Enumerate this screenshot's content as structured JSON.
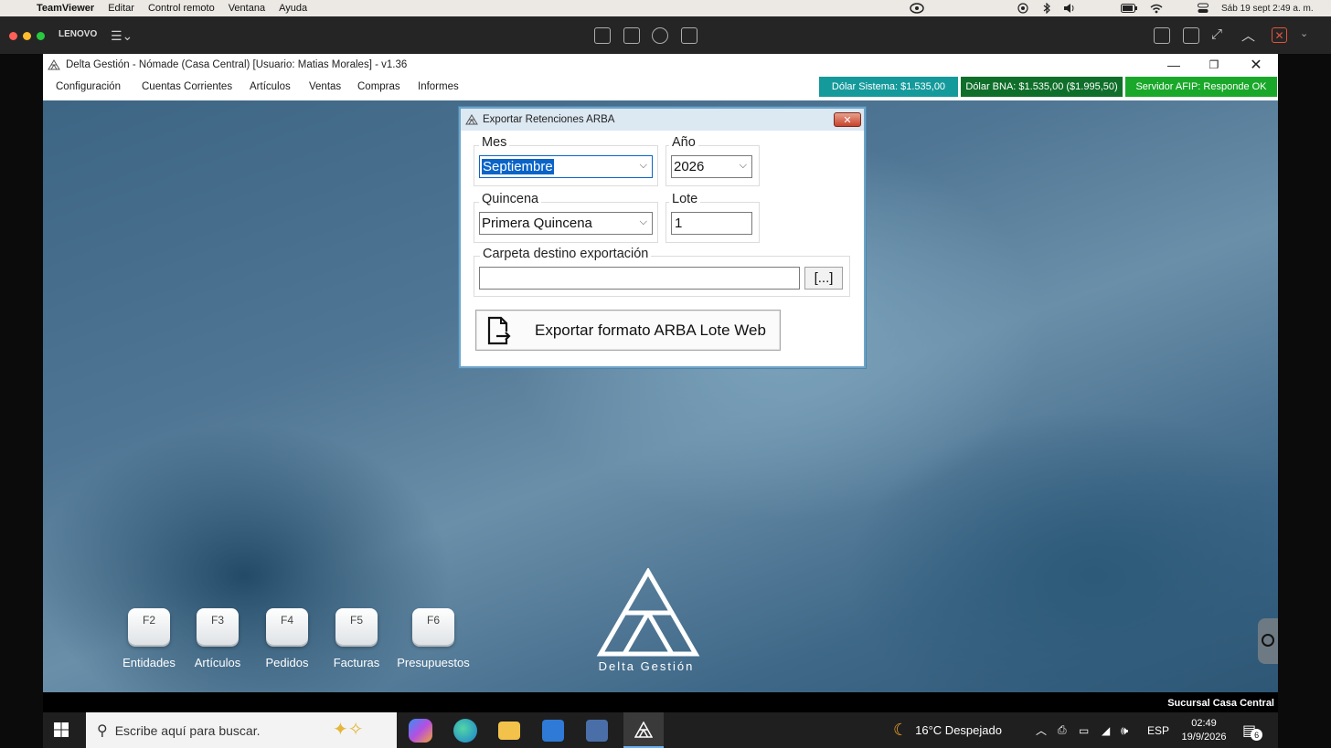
{
  "mac_menubar": {
    "app_name": "TeamViewer",
    "menus": [
      "Editar",
      "Control remoto",
      "Ventana",
      "Ayuda"
    ],
    "datetime": "Sáb 19 sept  2:49 a. m."
  },
  "teamviewer": {
    "session_name": "LENOVO"
  },
  "window": {
    "title": "Delta Gestión - Nómade (Casa Central) [Usuario: Matias  Morales] - v1.36",
    "menus": [
      "Configuración",
      "Cuentas Corrientes",
      "Artículos",
      "Ventas",
      "Compras",
      "Informes"
    ],
    "badges": {
      "dolar_sistema": "Dólar Sistema: $1.535,00",
      "dolar_bna": "Dólar BNA: $1.535,00 ($1.995,50)",
      "afip": "Servidor AFIP:  Responde OK"
    },
    "colors": {
      "dolar_sistema": "#159a9c",
      "dolar_bna": "#0f6f2a",
      "afip": "#1aa82a"
    }
  },
  "dialog": {
    "title": "Exportar Retenciones ARBA",
    "close_label": "✕",
    "mes": {
      "label": "Mes",
      "value": "Septiembre"
    },
    "anio": {
      "label": "Año",
      "value": "2026"
    },
    "quincena": {
      "label": "Quincena",
      "value": "Primera Quincena"
    },
    "lote": {
      "label": "Lote",
      "value": "1"
    },
    "carpeta": {
      "label": "Carpeta destino exportación",
      "value": "",
      "browse_label": "[...]"
    },
    "export_button": "Exportar formato ARBA Lote Web"
  },
  "shortcuts": [
    {
      "key": "F2",
      "label": "Entidades"
    },
    {
      "key": "F3",
      "label": "Artículos"
    },
    {
      "key": "F4",
      "label": "Pedidos"
    },
    {
      "key": "F5",
      "label": "Facturas"
    },
    {
      "key": "F6",
      "label": "Presupuestos"
    }
  ],
  "logo_text": "Delta Gestión",
  "branch_label": "Sucursal Casa Central",
  "taskbar": {
    "search_placeholder": "Escribe aquí para buscar.",
    "weather": "16°C  Despejado",
    "language": "ESP",
    "time": "02:49",
    "date": "19/9/2026",
    "notifications": "6"
  }
}
